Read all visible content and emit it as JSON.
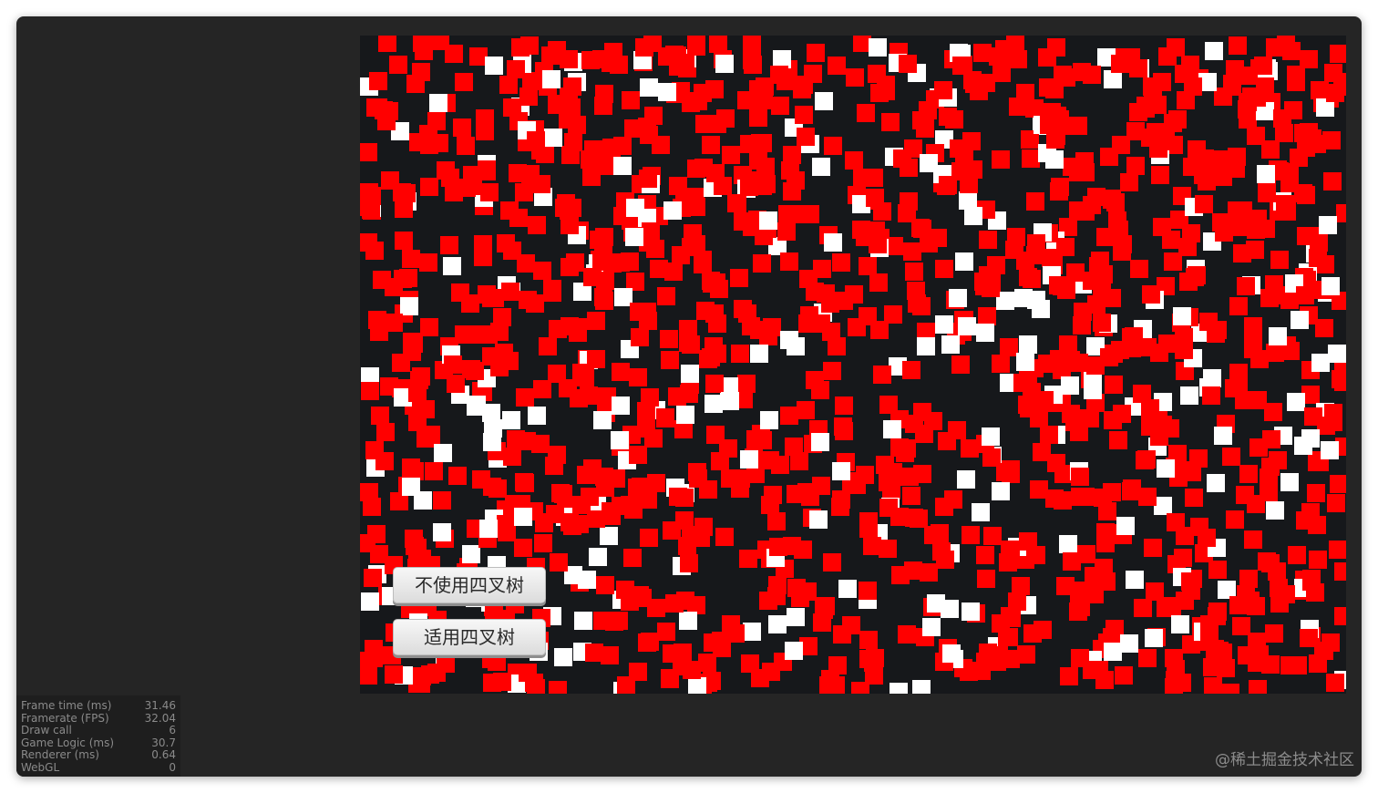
{
  "stage": {
    "background": "#16181b",
    "square_colors": {
      "colliding": "#ff0000",
      "free": "#ffffff"
    },
    "buttons": [
      {
        "label": "不使用四叉树"
      },
      {
        "label": "适用四叉树"
      }
    ]
  },
  "stats": [
    {
      "label": "Frame time (ms)",
      "value": "31.46"
    },
    {
      "label": "Framerate (FPS)",
      "value": "32.04"
    },
    {
      "label": "Draw call",
      "value": "6"
    },
    {
      "label": "Game Logic (ms)",
      "value": "30.7"
    },
    {
      "label": "Renderer (ms)",
      "value": "0.64"
    },
    {
      "label": "WebGL",
      "value": "0"
    }
  ],
  "watermark": "@稀土掘金技术社区"
}
